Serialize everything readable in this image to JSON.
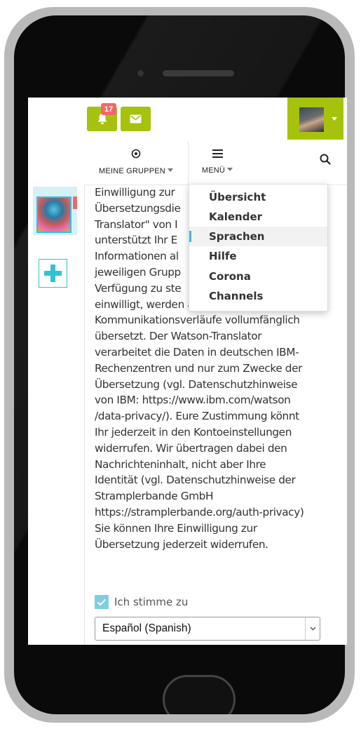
{
  "header": {
    "notifications_count": "17",
    "nav": {
      "groups_label": "MEINE GRUPPEN",
      "menu_label": "MENÜ"
    }
  },
  "menu": {
    "items": [
      {
        "label": "Übersicht"
      },
      {
        "label": "Kalender"
      },
      {
        "label": "Sprachen"
      },
      {
        "label": "Hilfe"
      },
      {
        "label": "Corona"
      },
      {
        "label": "Channels"
      }
    ],
    "active": "Sprachen"
  },
  "content": {
    "lines": [
      "Einwilligung zur",
      "Übersetzungsdie",
      "Translator\" von I",
      "unterstützt Ihr E",
      "Informationen al",
      "jeweiligen Grupp",
      "Verfügung zu ste",
      "einwilligt, werden alle",
      "Kommunikationsverläufe vollumfänglich",
      "übersetzt. Der Watson-Translator",
      "verarbeitet die Daten in deutschen IBM-",
      "Rechenzentren und nur zum Zwecke der",
      "Übersetzung (vgl. Datenschutzhinweise",
      "von IBM: https://www.ibm.com/watson",
      "/data-privacy/). Eure Zustimmung könnt",
      "Ihr jederzeit in den Kontoeinstellungen",
      "widerrufen. Wir übertragen dabei den",
      "Nachrichteninhalt, nicht aber Ihre",
      "Identität (vgl. Datenschutzhinweise der",
      "Stramplerbande GmbH",
      "https://stramplerbande.org/auth-privacy)",
      "Sie können Ihre Einwilligung zur",
      "Übersetzung jederzeit widerrufen."
    ],
    "consent_label": "Ich stimme zu",
    "language_select": "Español (Spanish)"
  },
  "colors": {
    "accent_green": "#a6c20c",
    "accent_cyan": "#33c1d6",
    "badge_red": "#ee6a6a"
  },
  "icons": {
    "notification": "bell-icon",
    "messages": "envelope-icon",
    "groups": "target-icon",
    "menu": "hamburger-icon",
    "search": "search-icon",
    "add": "plus-icon",
    "checkbox": "checkmark-icon"
  }
}
